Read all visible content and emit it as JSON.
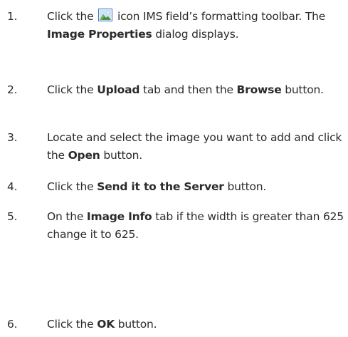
{
  "steps": [
    {
      "number": "1.",
      "pre": "Click the ",
      "icon": "image-icon",
      "post": " icon IMS field’s formatting toolbar.  The ",
      "bold1": "Image Properties",
      "post2": " dialog displays."
    },
    {
      "number": "2.",
      "pre": "Click the ",
      "bold1": "Upload",
      "mid": " tab and then the ",
      "bold2": "Browse",
      "post": " button."
    },
    {
      "number": "3.",
      "pre": "Locate and select the image you want to add and click the ",
      "bold1": "Open",
      "post": " button."
    },
    {
      "number": "4.",
      "pre": "Click the ",
      "bold1": "Send it to the Server",
      "post": " button."
    },
    {
      "number": "5.",
      "pre": "On the ",
      "bold1": "Image Info",
      "post": " tab if the width is greater than 625 change it to 625."
    },
    {
      "number": "6.",
      "pre": "Click the ",
      "bold1": "OK",
      "post": " button."
    }
  ],
  "colors": {
    "text": "#2b2b2b",
    "icon_frame": "#3a78c8",
    "icon_sky": "#cfe3f7",
    "icon_mountain": "#4a8f3c"
  }
}
